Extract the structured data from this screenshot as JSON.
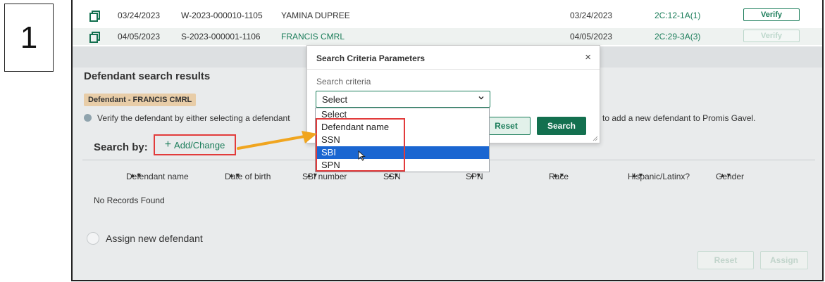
{
  "step_number": "1",
  "records": [
    {
      "date": "03/24/2023",
      "case_number": "W-2023-000010-1105",
      "name": "YAMINA DUPREE",
      "date2": "03/24/2023",
      "code": "2C:12-1A(1)",
      "action": "Verify"
    },
    {
      "date": "04/05/2023",
      "case_number": "S-2023-000001-1106",
      "name": "FRANCIS CMRL",
      "date2": "04/05/2023",
      "code": "2C:29-3A(3)",
      "action": "Verify"
    }
  ],
  "section": {
    "title": "Defendant search results",
    "defendant_pill": "Defendant - FRANCIS CMRL",
    "info_text": "Verify the defendant by either selecting a defendant",
    "info_text_tail": "to add a new defendant to Promis Gavel."
  },
  "search_by": {
    "label": "Search by:",
    "add_change_label": "Add/Change"
  },
  "columns": [
    "Defendant name",
    "Date of birth",
    "SBI number",
    "SSN",
    "SPN",
    "Race",
    "Hispanic/Latinx?",
    "Gender"
  ],
  "no_records": "No Records Found",
  "assign_new_label": "Assign new defendant",
  "footer_buttons": {
    "reset": "Reset",
    "assign": "Assign"
  },
  "modal": {
    "title": "Search Criteria Parameters",
    "close_glyph": "×",
    "criteria_label": "Search criteria",
    "select_value": "Select",
    "reset_label": "Reset",
    "search_label": "Search",
    "options": [
      "Select",
      "Defendant name",
      "SSN",
      "SBI",
      "SPN"
    ],
    "selected_option": "SBI"
  },
  "colors": {
    "accent_green": "#13704f",
    "link_green": "#1b7d5a",
    "highlight_red": "#e23b3b",
    "arrow_orange": "#f0a51f",
    "selection_blue": "#1a66d1"
  },
  "icons": [
    "copy-icon",
    "info-icon",
    "plus-icon",
    "sort-icon",
    "close-icon",
    "chevron-down-icon",
    "cursor-icon",
    "arrow-annotation"
  ]
}
